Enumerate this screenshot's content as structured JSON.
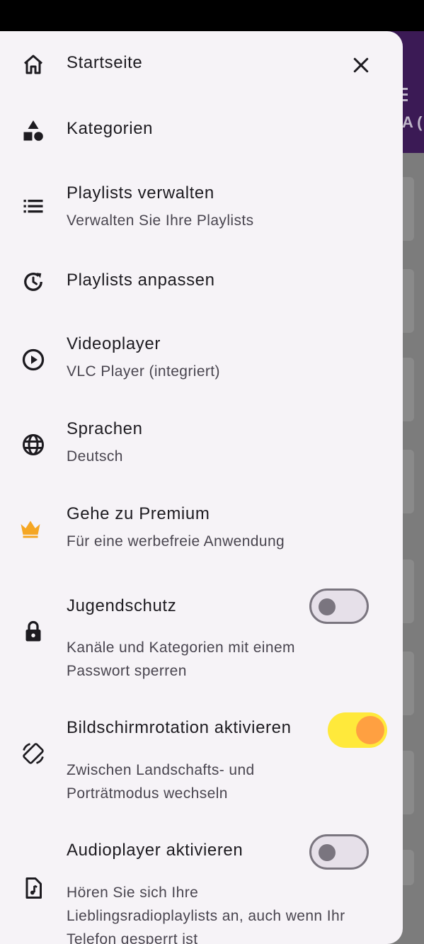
{
  "background": {
    "appbar_peek_text": "A ("
  },
  "drawer": {
    "close_icon": "close-icon",
    "items": [
      {
        "id": "home",
        "icon": "home-icon",
        "title": "Startseite"
      },
      {
        "id": "categories",
        "icon": "categories-icon",
        "title": "Kategorien"
      },
      {
        "id": "manage-playlists",
        "icon": "list-icon",
        "title": "Playlists verwalten",
        "subtitle": "Verwalten Sie Ihre Playlists"
      },
      {
        "id": "customize-playlists",
        "icon": "history-icon",
        "title": "Playlists anpassen"
      },
      {
        "id": "videoplayer",
        "icon": "play-circle-icon",
        "title": "Videoplayer",
        "subtitle": "VLC Player (integriert)"
      },
      {
        "id": "languages",
        "icon": "globe-icon",
        "title": "Sprachen",
        "subtitle": "Deutsch"
      },
      {
        "id": "premium",
        "icon": "crown-icon",
        "title": "Gehe zu Premium",
        "subtitle": "Für eine werbefreie Anwendung"
      }
    ],
    "settings": [
      {
        "id": "parental-control",
        "icon": "lock-icon",
        "title": "Jugendschutz",
        "subtitle_lines": [
          "Kanäle und Kategorien mit einem",
          "Passwort sperren"
        ],
        "enabled": false
      },
      {
        "id": "screen-rotation",
        "icon": "screen-rotation-icon",
        "title": "Bildschirmrotation aktivieren",
        "subtitle_lines": [
          "Zwischen Landschafts- und",
          "Porträtmodus wechseln"
        ],
        "enabled": true
      },
      {
        "id": "audioplayer",
        "icon": "music-file-icon",
        "title": "Audioplayer aktivieren",
        "subtitle_lines": [
          "Hören Sie sich Ihre",
          "Lieblingsradioplaylists an, auch wenn Ihr",
          "Telefon gesperrt ist"
        ],
        "enabled": false
      }
    ]
  },
  "colors": {
    "drawer_bg": "#f6f3f7",
    "appbar": "#3b1a55",
    "accent_crown": "#f5a623",
    "toggle_on_track": "#ffe93b",
    "toggle_on_knob": "#ffa041"
  }
}
